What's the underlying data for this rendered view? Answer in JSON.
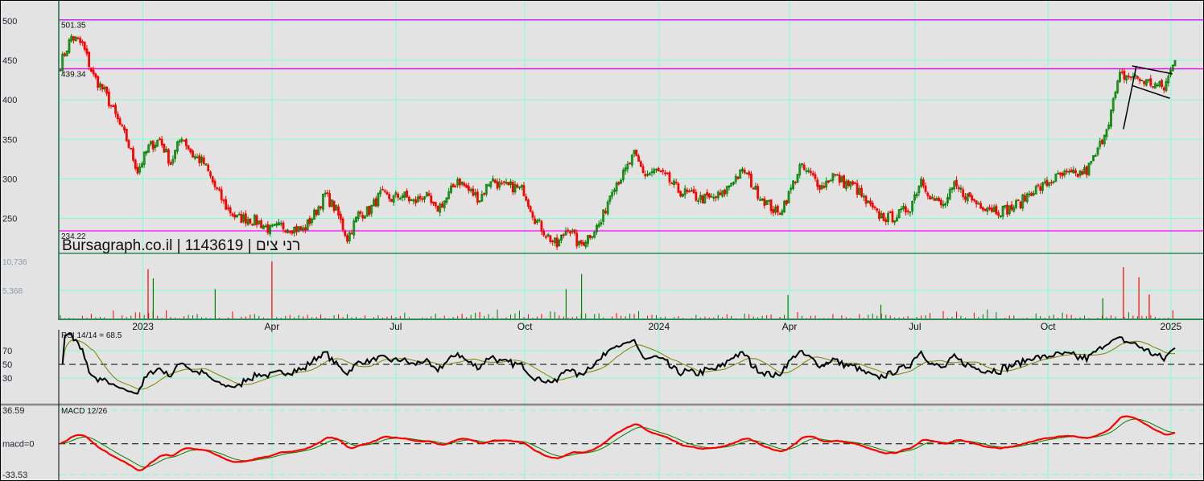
{
  "chart_data": {
    "type": "candlestick",
    "watermark": "Bursagraph.co.il | 1143619 | רני צים",
    "time_range": [
      2022.84,
      2025.0
    ],
    "price_axis": {
      "ylim": [
        210,
        520
      ],
      "ticks": [
        "500",
        "450",
        "400",
        "350",
        "300",
        "250"
      ],
      "grid": true
    },
    "x_ticks": [
      {
        "t": 2023.0,
        "label": "2023"
      },
      {
        "t": 2023.25,
        "label": "Apr"
      },
      {
        "t": 2023.49,
        "label": "Jul"
      },
      {
        "t": 2023.74,
        "label": "Oct"
      },
      {
        "t": 2024.0,
        "label": "2024"
      },
      {
        "t": 2024.253,
        "label": "Apr"
      },
      {
        "t": 2024.496,
        "label": "Jul"
      },
      {
        "t": 2024.754,
        "label": "Oct"
      },
      {
        "t": 2024.992,
        "label": "2025"
      }
    ],
    "horizontal_levels": [
      {
        "value": 501.35,
        "label": "501.35",
        "color": "#ff00ff"
      },
      {
        "value": 439.34,
        "label": "439.34",
        "color": "#ff00ff"
      },
      {
        "value": 234.22,
        "label": "234.22",
        "color": "#ff00ff"
      }
    ],
    "trendlines": [
      {
        "from": [
          2024.9,
          363
        ],
        "to": [
          2024.925,
          443
        ]
      },
      {
        "from": [
          2024.917,
          443
        ],
        "to": [
          2024.995,
          433
        ]
      },
      {
        "from": [
          2024.918,
          418
        ],
        "to": [
          2024.99,
          402
        ]
      }
    ],
    "closes": [
      445,
      480,
      470,
      430,
      410,
      380,
      350,
      310,
      340,
      350,
      320,
      355,
      330,
      320,
      290,
      265,
      250,
      250,
      245,
      235,
      240,
      238,
      235,
      255,
      280,
      260,
      225,
      255,
      260,
      280,
      275,
      280,
      270,
      280,
      260,
      275,
      300,
      285,
      275,
      300,
      290,
      290,
      285,
      250,
      230,
      215,
      240,
      215,
      230,
      245,
      290,
      305,
      330,
      305,
      310,
      300,
      285,
      280,
      275,
      275,
      280,
      300,
      310,
      285,
      270,
      255,
      280,
      315,
      305,
      290,
      305,
      295,
      290,
      270,
      255,
      250,
      255,
      265,
      300,
      275,
      265,
      290,
      280,
      270,
      265,
      260,
      262,
      270,
      285,
      290,
      300,
      305,
      305,
      310,
      335,
      375,
      430,
      430,
      425,
      420,
      415,
      450
    ],
    "volume": {
      "ticks": [
        "10,736",
        "5,368"
      ],
      "max": 10736,
      "spikes": [
        [
          2023.01,
          9300
        ],
        [
          2023.02,
          7600
        ],
        [
          2023.14,
          5600
        ],
        [
          2023.25,
          10736
        ],
        [
          2023.82,
          5600
        ],
        [
          2023.85,
          8400
        ],
        [
          2024.25,
          4500
        ],
        [
          2024.9,
          9700
        ],
        [
          2024.93,
          7800
        ],
        [
          2024.95,
          4600
        ],
        [
          2024.43,
          2700
        ],
        [
          2024.86,
          3900
        ]
      ]
    },
    "rsi": {
      "label": "RSI 14/14 = 68.5",
      "period": 14,
      "ticks": [
        "70",
        "50",
        "30"
      ],
      "value": 68.5
    },
    "macd": {
      "label": "MACD 12/26",
      "fast": 12,
      "slow": 26,
      "ticks": [
        "36.59",
        "macd=0",
        "-33.53"
      ],
      "ylim": [
        -33.53,
        36.59
      ]
    },
    "colors": {
      "up": "#008000",
      "down": "#ff0000",
      "grid": "#7fffd4",
      "level": "#ff00ff",
      "rsi": "#000000",
      "rsi_ma": "#808000",
      "macd": "#ff0000",
      "signal": "#008000"
    }
  }
}
